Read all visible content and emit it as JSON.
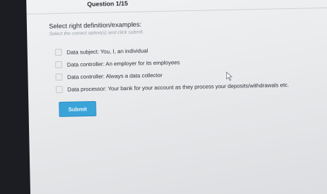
{
  "quiz": {
    "question_counter": "Question 1/15",
    "title": "Select right definition/examples:",
    "hint": "Select the correct option(s) and click submit.",
    "options": [
      {
        "label": "Data subject: You, I, an individual"
      },
      {
        "label": "Data controller: An employer for its employees"
      },
      {
        "label": "Data controller: Always a data collector"
      },
      {
        "label": "Data processor: Your bank for your account as they process your deposits/withdrawals etc."
      }
    ],
    "submit_label": "Submit"
  },
  "colors": {
    "submit_button": "#3aa3d8",
    "page_background": "#eceded"
  },
  "icons": {
    "pointer": "mouse-pointer-icon"
  }
}
